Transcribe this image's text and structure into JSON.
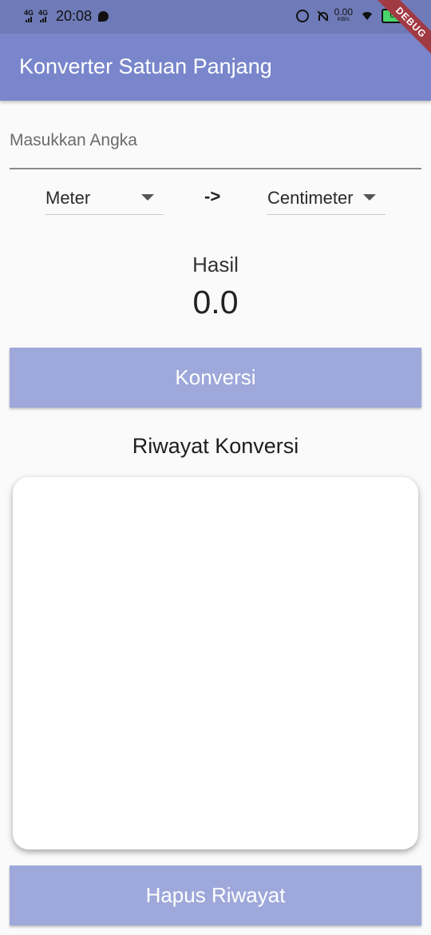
{
  "status_bar": {
    "network_1": "4G",
    "network_2": "4G",
    "time": "20:08",
    "speed_value": "0.00",
    "speed_unit": "KB/s",
    "battery": "68"
  },
  "debug_banner": "DEBUG",
  "app_bar": {
    "title": "Konverter Satuan Panjang"
  },
  "input": {
    "placeholder": "Masukkan Angka",
    "value": ""
  },
  "conversion": {
    "from_unit": "Meter",
    "arrow": "->",
    "to_unit": "Centimeter"
  },
  "result": {
    "label": "Hasil",
    "value": "0.0"
  },
  "buttons": {
    "convert_label": "Konversi",
    "clear_label": "Hapus Riwayat"
  },
  "history": {
    "title": "Riwayat Konversi",
    "items": []
  },
  "colors": {
    "status_bar": "#6f7bb8",
    "app_bar": "#7986cb",
    "button": "#9ea8da",
    "background": "#fafafa"
  }
}
